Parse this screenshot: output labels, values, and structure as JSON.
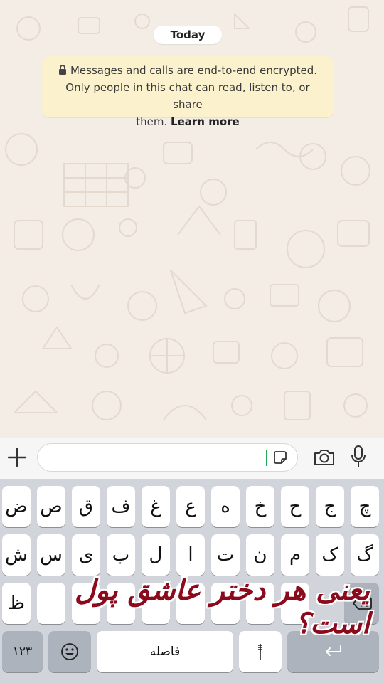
{
  "chat": {
    "date_label": "Today",
    "encryption_notice": {
      "line1": "Messages and calls are end-to-end encrypted.",
      "line2": "Only people in this chat can read, listen to, or share",
      "line3_prefix": "them.",
      "learn_more": "Learn more"
    }
  },
  "composer": {
    "icons": [
      "plus-icon",
      "sticker-icon",
      "camera-icon",
      "microphone-icon"
    ],
    "value": ""
  },
  "keyboard": {
    "row1": [
      "ض",
      "ص",
      "ق",
      "ف",
      "غ",
      "ع",
      "ه",
      "خ",
      "ح",
      "ج",
      "چ"
    ],
    "row2": [
      "ش",
      "س",
      "ی",
      "ب",
      "ل",
      "ا",
      "ت",
      "ن",
      "م",
      "ک",
      "گ"
    ],
    "row3_first": "ظ",
    "numbers_key": "۱۲۳",
    "space_label": "فاصله",
    "icons": [
      "backspace-icon",
      "emoji-icon",
      "return-icon"
    ]
  },
  "overlay_caption": "یعنی هر دختر عاشق پول است؟"
}
